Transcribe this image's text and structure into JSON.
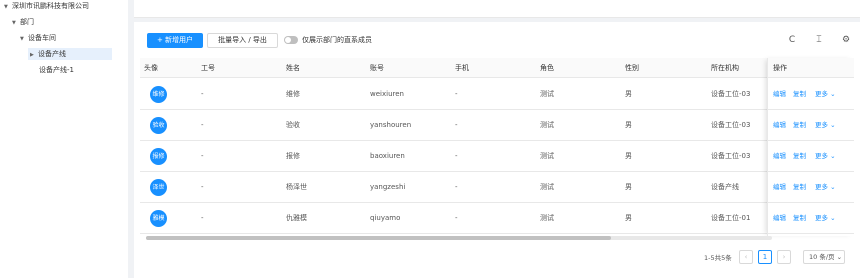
{
  "tree": {
    "root": "深圳市讯鹏科技有限公司",
    "dept": "部门",
    "workshop": "设备车间",
    "line_selected": "设备产线",
    "line_other": "设备产线-1"
  },
  "toolbar": {
    "add_user": "+ 新增用户",
    "batch": "批量导入 / 导出",
    "toggle_label": "仅展示部门的直系成员",
    "toggle_on": false
  },
  "table": {
    "headers": {
      "avatar": "头像",
      "employee_no": "工号",
      "name": "姓名",
      "account": "账号",
      "phone": "手机",
      "role": "角色",
      "gender": "性别",
      "org": "所在机构",
      "ops": "操作"
    },
    "rows": [
      {
        "avatar": "维修",
        "employee_no": "-",
        "name": "维修",
        "account": "weixiuren",
        "phone": "-",
        "role": "测试",
        "gender": "男",
        "org": "设备工位-03"
      },
      {
        "avatar": "验收",
        "employee_no": "-",
        "name": "验收",
        "account": "yanshouren",
        "phone": "-",
        "role": "测试",
        "gender": "男",
        "org": "设备工位-03"
      },
      {
        "avatar": "报修",
        "employee_no": "-",
        "name": "报修",
        "account": "baoxiuren",
        "phone": "-",
        "role": "测试",
        "gender": "男",
        "org": "设备工位-03"
      },
      {
        "avatar": "泽世",
        "employee_no": "-",
        "name": "杨泽世",
        "account": "yangzeshi",
        "phone": "-",
        "role": "测试",
        "gender": "男",
        "org": "设备产线"
      },
      {
        "avatar": "雅模",
        "employee_no": "-",
        "name": "仇雅模",
        "account": "qiuyamo",
        "phone": "-",
        "role": "测试",
        "gender": "男",
        "org": "设备工位-01"
      }
    ],
    "actions": {
      "edit": "编辑",
      "copy": "复制",
      "more": "更多"
    }
  },
  "pagination": {
    "total": "1-5共5条",
    "page": "1",
    "page_size": "10 条/页"
  },
  "colors": {
    "primary": "#1890ff"
  }
}
